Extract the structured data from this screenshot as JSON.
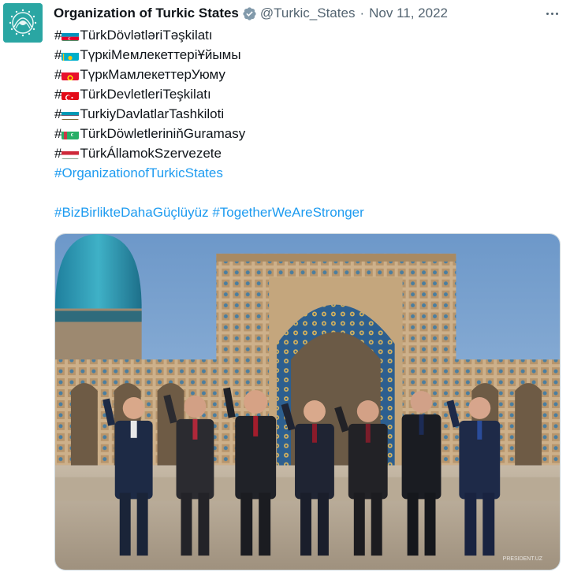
{
  "account": {
    "name": "Organization of Turkic States",
    "handle": "@Turkic_States",
    "separator": "·",
    "date": "Nov 11, 2022",
    "avatar_icon": "ots-logo-icon",
    "verified_icon": "verified-badge-icon"
  },
  "tweet": {
    "hash": "#",
    "lines": [
      {
        "flag": "azerbaijan",
        "text": "TürkDövlətləriTəşkilatı"
      },
      {
        "flag": "kazakhstan",
        "text": "ТүркіМемлекеттеріҰйымы"
      },
      {
        "flag": "kyrgyzstan",
        "text": "ТүркМамлекеттерУюму"
      },
      {
        "flag": "turkey",
        "text": "TürkDevletleriTeşkilatı"
      },
      {
        "flag": "uzbekistan",
        "text": "TurkiyDavlatlarTashkiloti"
      },
      {
        "flag": "turkmenistan",
        "text": "TürkDöwletleriniňGuramasy"
      },
      {
        "flag": "hungary",
        "text": "TürkÁllamokSzervezete"
      }
    ],
    "hashtag_line": "#OrganizationofTurkicStates",
    "hashtags": [
      "#BizBirlikteDahaGüçlüyüz",
      "#TogetherWeAreStronger"
    ]
  },
  "media": {
    "description_icon": "photo-image",
    "watermark": "PRESIDENT.UZ"
  },
  "colors": {
    "link": "#1d9bf0",
    "secondary": "#536471",
    "primary": "#0f1419",
    "avatar_bg": "#2aa6a3"
  }
}
